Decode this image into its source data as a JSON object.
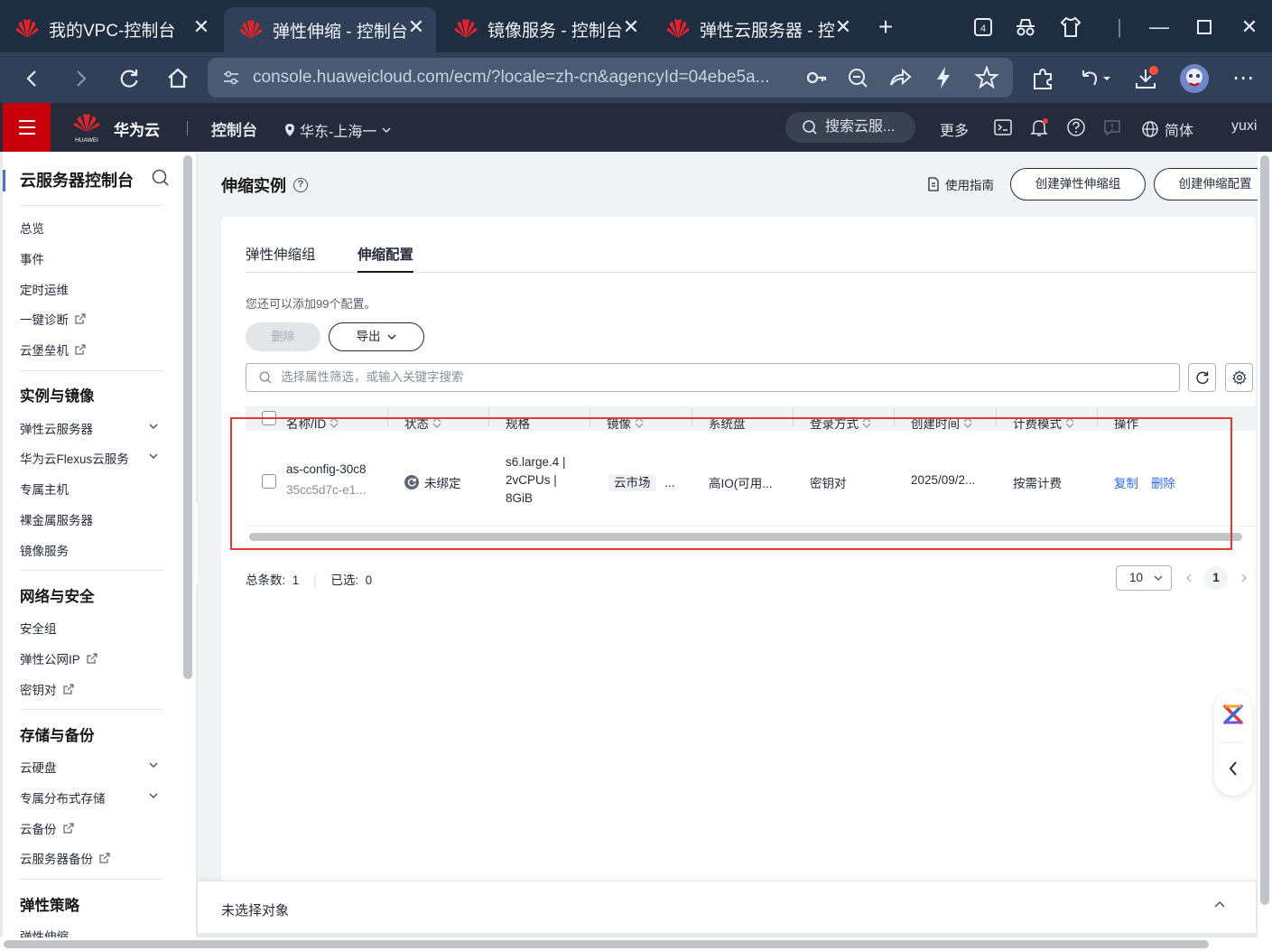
{
  "browser": {
    "tabs": [
      {
        "title": "我的VPC-控制台"
      },
      {
        "title": "弹性伸缩 - 控制台"
      },
      {
        "title": "镜像服务 - 控制台"
      },
      {
        "title": "弹性云服务器 - 控"
      }
    ],
    "tab_count_badge": "4",
    "url": "console.huaweicloud.com/ecm/?locale=zh-cn&agencyId=04ebe5a..."
  },
  "header": {
    "logo_text": "HUAWEI",
    "brand": "华为云",
    "console": "控制台",
    "region": "华东-上海一",
    "search_placeholder": "搜索云服...",
    "more": "更多",
    "language": "简体",
    "user": "yuxi"
  },
  "sidebar": {
    "title": "云服务器控制台",
    "top_items": [
      {
        "label": "总览"
      },
      {
        "label": "事件"
      },
      {
        "label": "定时运维"
      },
      {
        "label": "一键诊断"
      },
      {
        "label": "云堡垒机"
      }
    ],
    "groups": [
      {
        "title": "实例与镜像",
        "items": [
          {
            "label": "弹性云服务器"
          },
          {
            "label": "华为云Flexus云服务"
          },
          {
            "label": "专属主机"
          },
          {
            "label": "裸金属服务器"
          },
          {
            "label": "镜像服务"
          }
        ]
      },
      {
        "title": "网络与安全",
        "items": [
          {
            "label": "安全组"
          },
          {
            "label": "弹性公网IP"
          },
          {
            "label": "密钥对"
          }
        ]
      },
      {
        "title": "存储与备份",
        "items": [
          {
            "label": "云硬盘"
          },
          {
            "label": "专属分布式存储"
          },
          {
            "label": "云备份"
          },
          {
            "label": "云服务器备份"
          }
        ]
      },
      {
        "title": "弹性策略",
        "items": [
          {
            "label": "弹性伸缩"
          }
        ]
      }
    ]
  },
  "main": {
    "page_title": "伸缩实例",
    "guide": "使用指南",
    "create_group_button": "创建弹性伸缩组",
    "create_config_button": "创建伸缩配置",
    "tabs": [
      {
        "label": "弹性伸缩组"
      },
      {
        "label": "伸缩配置"
      }
    ],
    "quota_text": "您还可以添加99个配置。",
    "delete_button": "删除",
    "export_button": "导出",
    "filter_placeholder": "选择属性筛选，或输入关键字搜索",
    "columns": [
      {
        "label": "名称/ID"
      },
      {
        "label": "状态"
      },
      {
        "label": "规格"
      },
      {
        "label": "镜像"
      },
      {
        "label": "系统盘"
      },
      {
        "label": "登录方式"
      },
      {
        "label": "创建时间"
      },
      {
        "label": "计费模式"
      },
      {
        "label": "操作"
      }
    ],
    "rows": [
      {
        "name": "as-config-30c8",
        "id": "35cc5d7c-e1...",
        "status": "未绑定",
        "spec_line1": "s6.large.4 |",
        "spec_line2": "2vCPUs |",
        "spec_line3": "8GiB",
        "image": "云市场",
        "image_more": "...",
        "system_disk": "高IO(可用...",
        "login": "密钥对",
        "created": "2025/09/2...",
        "billing": "按需计费",
        "action_copy": "复制",
        "action_delete": "删除"
      }
    ],
    "total_label": "总条数:",
    "total_value": "1",
    "selected_label": "已选:",
    "selected_value": "0",
    "page_size": "10",
    "current_page": "1"
  },
  "bottom_bar": {
    "text": "未选择对象"
  }
}
